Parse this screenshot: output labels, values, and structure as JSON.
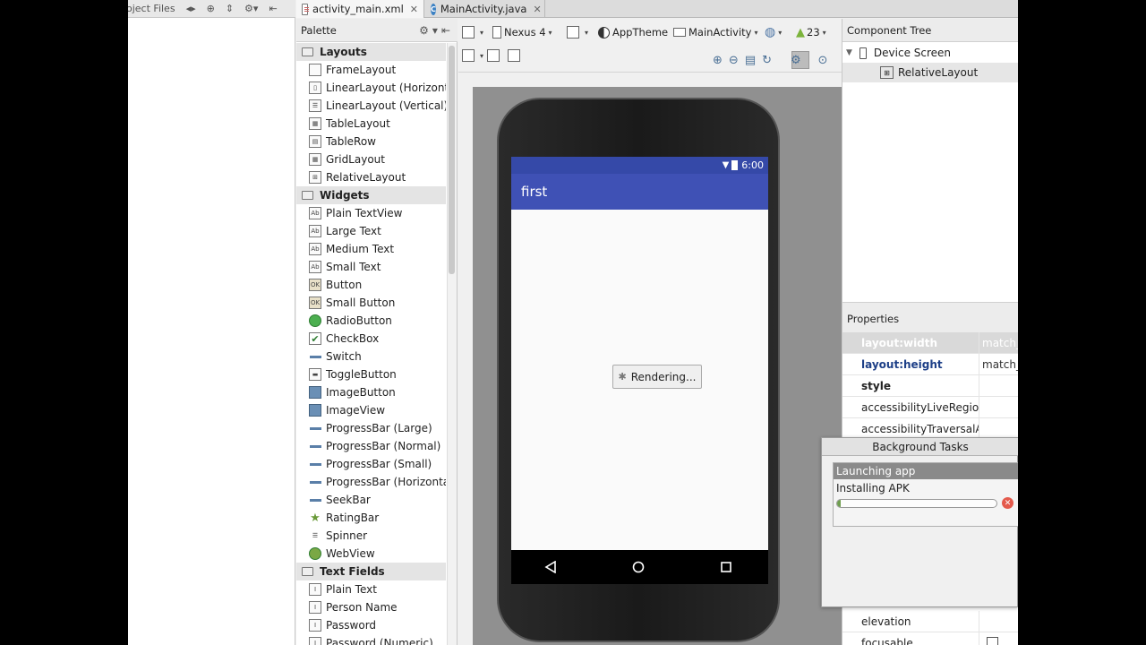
{
  "project_toolbar": {
    "label": "oject Files"
  },
  "tabs": [
    {
      "label": "activity_main.xml",
      "active": true
    },
    {
      "label": "MainActivity.java",
      "active": false
    }
  ],
  "palette": {
    "title": "Palette",
    "categories": [
      {
        "label": "Layouts",
        "items": [
          "FrameLayout",
          "LinearLayout (Horizontal)",
          "LinearLayout (Vertical)",
          "TableLayout",
          "TableRow",
          "GridLayout",
          "RelativeLayout"
        ]
      },
      {
        "label": "Widgets",
        "items": [
          "Plain TextView",
          "Large Text",
          "Medium Text",
          "Small Text",
          "Button",
          "Small Button",
          "RadioButton",
          "CheckBox",
          "Switch",
          "ToggleButton",
          "ImageButton",
          "ImageView",
          "ProgressBar (Large)",
          "ProgressBar (Normal)",
          "ProgressBar (Small)",
          "ProgressBar (Horizontal)",
          "SeekBar",
          "RatingBar",
          "Spinner",
          "WebView"
        ]
      },
      {
        "label": "Text Fields",
        "items": [
          "Plain Text",
          "Person Name",
          "Password",
          "Password (Numeric)"
        ]
      }
    ]
  },
  "design_toolbar": {
    "device": "Nexus 4",
    "theme": "AppTheme",
    "activity": "MainActivity",
    "api": "23"
  },
  "device_preview": {
    "status_time": "6:00",
    "app_title": "first",
    "rendering_label": "Rendering..."
  },
  "component_tree": {
    "title": "Component Tree",
    "root": "Device Screen",
    "child": "RelativeLayout"
  },
  "properties": {
    "title": "Properties",
    "rows": [
      {
        "key": "layout:width",
        "value": "match_"
      },
      {
        "key": "layout:height",
        "value": "match_"
      },
      {
        "key": "style",
        "value": ""
      },
      {
        "key": "accessibilityLiveRegion",
        "value": ""
      },
      {
        "key": "accessibilityTraversalAfte",
        "value": ""
      },
      {
        "key": "elevation",
        "value": ""
      },
      {
        "key": "focusable",
        "value": ""
      }
    ]
  },
  "background_tasks": {
    "title": "Background Tasks",
    "task_title": "Launching app",
    "task_status": "Installing APK",
    "progress": 0.02
  },
  "colors": {
    "action_bar": "#3f51b5",
    "status_bar": "#3549a8"
  }
}
